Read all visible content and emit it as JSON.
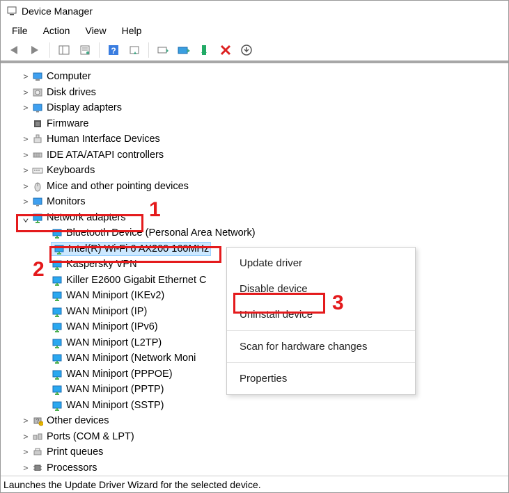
{
  "window": {
    "title": "Device Manager"
  },
  "menu": {
    "file": "File",
    "action": "Action",
    "view": "View",
    "help": "Help"
  },
  "tree": {
    "items": [
      {
        "label": "Computer",
        "icon": "computer-icon",
        "expander": ">"
      },
      {
        "label": "Disk drives",
        "icon": "disk-icon",
        "expander": ">"
      },
      {
        "label": "Display adapters",
        "icon": "display-icon",
        "expander": ">"
      },
      {
        "label": "Firmware",
        "icon": "firmware-icon",
        "expander": ""
      },
      {
        "label": "Human Interface Devices",
        "icon": "hid-icon",
        "expander": ">"
      },
      {
        "label": "IDE ATA/ATAPI controllers",
        "icon": "ide-icon",
        "expander": ">"
      },
      {
        "label": "Keyboards",
        "icon": "keyboard-icon",
        "expander": ">"
      },
      {
        "label": "Mice and other pointing devices",
        "icon": "mouse-icon",
        "expander": ">"
      },
      {
        "label": "Monitors",
        "icon": "monitor-icon",
        "expander": ">"
      }
    ],
    "network_adapters": {
      "label": "Network adapters",
      "expander": "v",
      "children": [
        "Bluetooth Device (Personal Area Network)",
        "Intel(R) Wi-Fi 6 AX200 160MHz",
        "Kaspersky VPN",
        "Killer E2600 Gigabit Ethernet C",
        "WAN Miniport (IKEv2)",
        "WAN Miniport (IP)",
        "WAN Miniport (IPv6)",
        "WAN Miniport (L2TP)",
        "WAN Miniport (Network Moni",
        "WAN Miniport (PPPOE)",
        "WAN Miniport (PPTP)",
        "WAN Miniport (SSTP)"
      ]
    },
    "after": [
      {
        "label": "Other devices",
        "icon": "other-icon",
        "expander": ">"
      },
      {
        "label": "Ports (COM & LPT)",
        "icon": "port-icon",
        "expander": ">"
      },
      {
        "label": "Print queues",
        "icon": "printer-icon",
        "expander": ">"
      },
      {
        "label": "Processors",
        "icon": "cpu-icon",
        "expander": ">"
      }
    ]
  },
  "context_menu": {
    "update": "Update driver",
    "disable": "Disable device",
    "uninstall": "Uninstall device",
    "scan": "Scan for hardware changes",
    "properties": "Properties"
  },
  "callouts": {
    "one": "1",
    "two": "2",
    "three": "3"
  },
  "status": "Launches the Update Driver Wizard for the selected device."
}
